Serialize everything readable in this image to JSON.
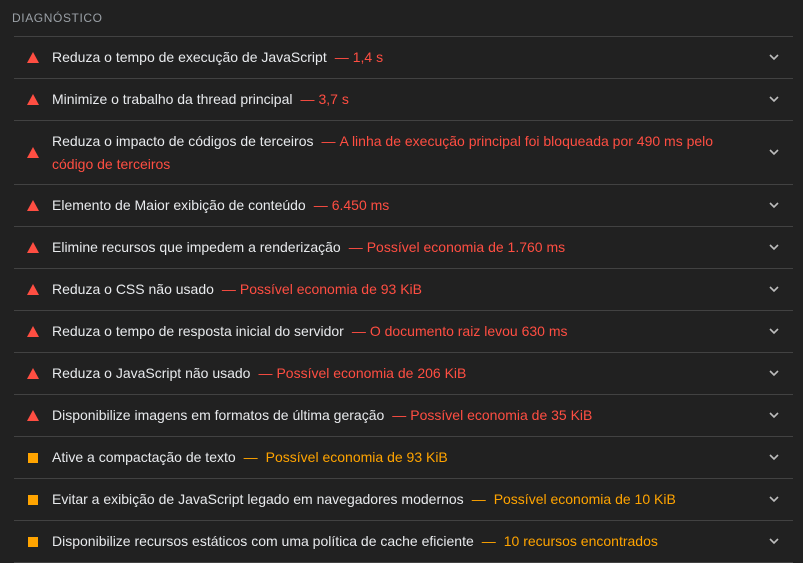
{
  "section": {
    "title": "DIAGNÓSTICO"
  },
  "audits": [
    {
      "status": "fail",
      "title": "Reduza o tempo de execução de JavaScript",
      "separator": "—",
      "display": "1,4 s"
    },
    {
      "status": "fail",
      "title": "Minimize o trabalho da thread principal",
      "separator": "—",
      "display": "3,7 s"
    },
    {
      "status": "fail",
      "title": "Reduza o impacto de códigos de terceiros",
      "separator": "—",
      "display": "A linha de execução principal foi bloqueada por 490 ms pelo código de terceiros"
    },
    {
      "status": "fail",
      "title": "Elemento de Maior exibição de conteúdo",
      "separator": "—",
      "display": "6.450 ms"
    },
    {
      "status": "fail",
      "title": "Elimine recursos que impedem a renderização",
      "separator": "—",
      "display": "Possível economia de 1.760 ms"
    },
    {
      "status": "fail",
      "title": "Reduza o CSS não usado",
      "separator": "—",
      "display": "Possível economia de 93 KiB"
    },
    {
      "status": "fail",
      "title": "Reduza o tempo de resposta inicial do servidor",
      "separator": "—",
      "display": "O documento raiz levou 630 ms"
    },
    {
      "status": "fail",
      "title": "Reduza o JavaScript não usado",
      "separator": "—",
      "display": "Possível economia de 206 KiB"
    },
    {
      "status": "fail",
      "title": "Disponibilize imagens em formatos de última geração",
      "separator": "—",
      "display": "Possível economia de 35 KiB"
    },
    {
      "status": "average",
      "title": "Ative a compactação de texto",
      "separator": "—",
      "display": "Possível economia de 93 KiB"
    },
    {
      "status": "average",
      "title": "Evitar a exibição de JavaScript legado em navegadores modernos",
      "separator": "—",
      "display": "Possível economia de 10 KiB"
    },
    {
      "status": "average",
      "title": "Disponibilize recursos estáticos com uma política de cache eficiente",
      "separator": "—",
      "display": "10 recursos encontrados"
    }
  ],
  "colors": {
    "fail": "#ff4e42",
    "average": "#ffa400",
    "background": "#212121"
  },
  "icons": {
    "fail": "triangle-warning-icon",
    "average": "square-average-icon",
    "expand": "chevron-down-icon"
  }
}
